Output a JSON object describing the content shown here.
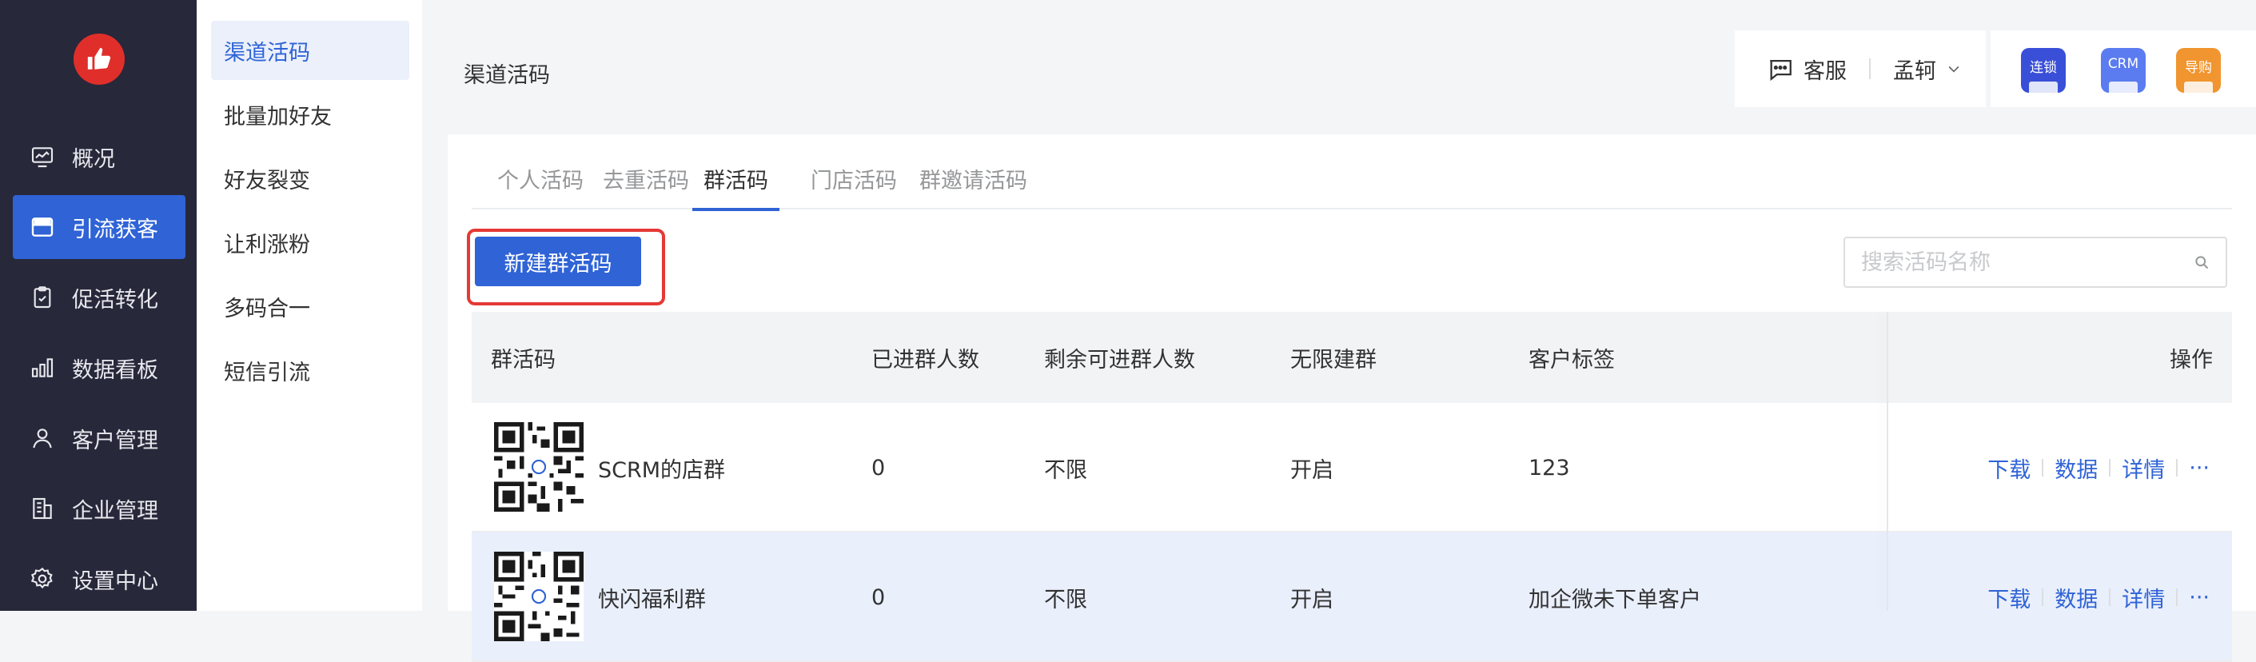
{
  "nav": {
    "items": [
      {
        "label": "概况",
        "icon": "dashboard-icon"
      },
      {
        "label": "引流获客",
        "icon": "storefront-icon"
      },
      {
        "label": "促活转化",
        "icon": "clipboard-icon"
      },
      {
        "label": "数据看板",
        "icon": "bar-chart-icon"
      },
      {
        "label": "客户管理",
        "icon": "user-icon"
      },
      {
        "label": "企业管理",
        "icon": "building-icon"
      },
      {
        "label": "设置中心",
        "icon": "gear-icon"
      }
    ],
    "active_index": 1
  },
  "submenu": {
    "items": [
      "渠道活码",
      "批量加好友",
      "好友裂变",
      "让利涨粉",
      "多码合一",
      "短信引流"
    ],
    "active_index": 0
  },
  "header": {
    "page_title": "渠道活码",
    "service_label": "客服",
    "user_name": "孟轲",
    "apps": [
      {
        "label": "连锁",
        "color": "#3a4fd8"
      },
      {
        "label": "CRM",
        "color": "#5b7cf0"
      },
      {
        "label": "导购",
        "color": "#f0952f"
      }
    ]
  },
  "tabs": [
    "个人活码",
    "去重活码",
    "群活码",
    "门店活码",
    "群邀请活码"
  ],
  "active_tab": 2,
  "toolbar": {
    "create_label": "新建群活码",
    "search_placeholder": "搜索活码名称"
  },
  "table": {
    "columns": [
      "群活码",
      "已进群人数",
      "剩余可进群人数",
      "无限建群",
      "客户标签",
      "操作"
    ],
    "rows": [
      {
        "name": "SCRM的店群",
        "joined": "0",
        "remaining": "不限",
        "unlimited": "开启",
        "tags": "123"
      },
      {
        "name": "快闪福利群",
        "joined": "0",
        "remaining": "不限",
        "unlimited": "开启",
        "tags": "加企微未下单客户"
      }
    ],
    "actions": [
      "下载",
      "数据",
      "详情",
      "···"
    ]
  }
}
